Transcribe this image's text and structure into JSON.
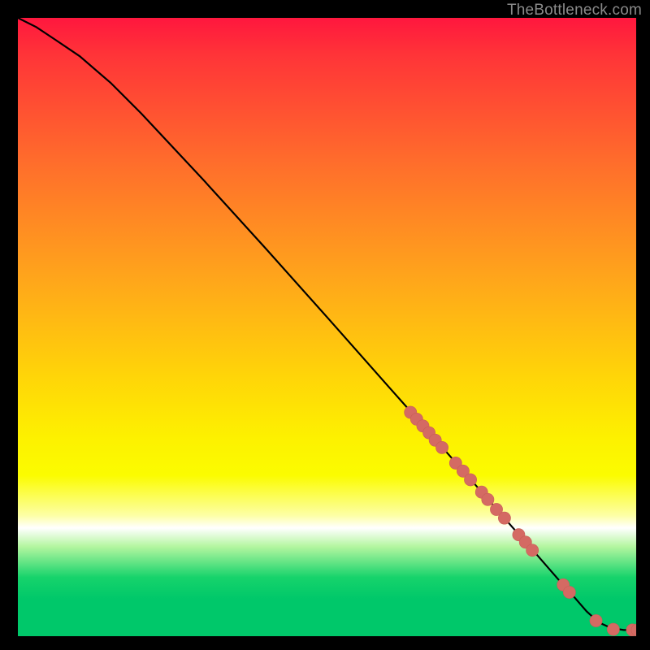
{
  "watermark": "TheBottleneck.com",
  "colors": {
    "page_bg": "#000000",
    "curve": "#000000",
    "marker_fill": "#d46a63",
    "marker_stroke": "#c85e57",
    "gradient_stops": [
      "#ff173e",
      "#ff6f2b",
      "#ffd508",
      "#fdffa6",
      "#ffffff",
      "#16d36b",
      "#00c86a"
    ]
  },
  "chart_data": {
    "type": "line",
    "title": "",
    "xlabel": "",
    "ylabel": "",
    "xlim": [
      0,
      100
    ],
    "ylim": [
      0,
      100
    ],
    "grid": false,
    "series": [
      {
        "name": "curve",
        "x": [
          0,
          3,
          6,
          10,
          15,
          20,
          30,
          40,
          50,
          60,
          64,
          70,
          76,
          80,
          84,
          88,
          90,
          92,
          94,
          96,
          98,
          100
        ],
        "y": [
          100,
          98.5,
          96.5,
          93.8,
          89.5,
          84.5,
          73.8,
          62.8,
          51.6,
          40.3,
          35.8,
          29.0,
          22.2,
          17.6,
          13.1,
          8.5,
          6.3,
          4.0,
          2.2,
          1.3,
          1.0,
          1.0
        ]
      }
    ],
    "markers": [
      {
        "x": 63.5,
        "y": 36.2
      },
      {
        "x": 64.5,
        "y": 35.1
      },
      {
        "x": 65.5,
        "y": 34.0
      },
      {
        "x": 66.5,
        "y": 32.9
      },
      {
        "x": 67.5,
        "y": 31.7
      },
      {
        "x": 68.6,
        "y": 30.5
      },
      {
        "x": 70.8,
        "y": 28.0
      },
      {
        "x": 72.0,
        "y": 26.7
      },
      {
        "x": 73.2,
        "y": 25.3
      },
      {
        "x": 75.0,
        "y": 23.3
      },
      {
        "x": 76.0,
        "y": 22.1
      },
      {
        "x": 77.4,
        "y": 20.5
      },
      {
        "x": 78.7,
        "y": 19.1
      },
      {
        "x": 81.0,
        "y": 16.4
      },
      {
        "x": 82.1,
        "y": 15.2
      },
      {
        "x": 83.2,
        "y": 13.9
      },
      {
        "x": 88.2,
        "y": 8.3
      },
      {
        "x": 89.2,
        "y": 7.1
      },
      {
        "x": 93.5,
        "y": 2.5
      },
      {
        "x": 96.3,
        "y": 1.1
      },
      {
        "x": 99.4,
        "y": 1.0
      },
      {
        "x": 100.2,
        "y": 1.0
      }
    ],
    "marker_radius": 7.6
  }
}
